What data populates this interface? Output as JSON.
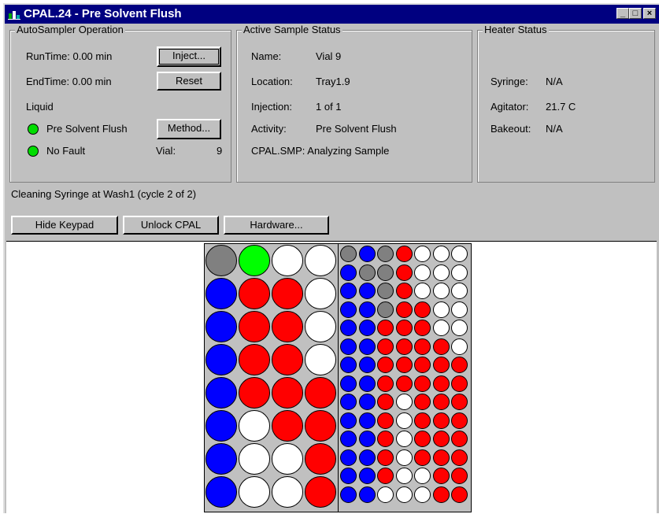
{
  "window": {
    "title": "CPAL.24 - Pre Solvent Flush"
  },
  "autosampler": {
    "title": "AutoSampler Operation",
    "runtime": "RunTime:  0.00 min",
    "endtime": "EndTime:  0.00 min",
    "liquid": "Liquid",
    "status1": "Pre Solvent Flush",
    "status2": "No Fault",
    "vial_label": "Vial:",
    "vial_value": "9",
    "inject_btn": "Inject...",
    "reset_btn": "Reset",
    "method_btn": "Method..."
  },
  "active": {
    "title": "Active Sample Status",
    "rows": [
      {
        "label": "Name:",
        "value": "Vial 9"
      },
      {
        "label": "Location:",
        "value": "Tray1.9"
      },
      {
        "label": "Injection:",
        "value": "1 of 1"
      },
      {
        "label": "Activity:",
        "value": "Pre Solvent Flush"
      }
    ],
    "status_line": "CPAL.SMP: Analyzing Sample"
  },
  "heater": {
    "title": "Heater Status",
    "rows": [
      {
        "label": "Syringe:",
        "value": "N/A"
      },
      {
        "label": "Agitator:",
        "value": "21.7 C"
      },
      {
        "label": "Bakeout:",
        "value": "N/A"
      }
    ]
  },
  "message": "Cleaning Syringe at Wash1 (cycle 2 of 2)",
  "buttons": {
    "hide_keypad": "Hide Keypad",
    "unlock": "Unlock CPAL",
    "hardware": "Hardware..."
  },
  "colors": {
    "gray": "#808080",
    "green": "#00ff00",
    "white": "#ffffff",
    "blue": "#0000ff",
    "red": "#ff0000"
  },
  "large_tray": [
    [
      "gray",
      "green",
      "white",
      "white"
    ],
    [
      "blue",
      "red",
      "red",
      "white"
    ],
    [
      "blue",
      "red",
      "red",
      "white"
    ],
    [
      "blue",
      "red",
      "red",
      "white"
    ],
    [
      "blue",
      "red",
      "red",
      "red"
    ],
    [
      "blue",
      "white",
      "red",
      "red"
    ],
    [
      "blue",
      "white",
      "white",
      "red"
    ],
    [
      "blue",
      "white",
      "white",
      "red"
    ]
  ],
  "small_tray": [
    [
      "gray",
      "blue",
      "gray",
      "red",
      "white",
      "white",
      "white"
    ],
    [
      "blue",
      "gray",
      "gray",
      "red",
      "white",
      "white",
      "white"
    ],
    [
      "blue",
      "blue",
      "gray",
      "red",
      "white",
      "white",
      "white"
    ],
    [
      "blue",
      "blue",
      "gray",
      "red",
      "red",
      "white",
      "white"
    ],
    [
      "blue",
      "blue",
      "red",
      "red",
      "red",
      "white",
      "white"
    ],
    [
      "blue",
      "blue",
      "red",
      "red",
      "red",
      "red",
      "white"
    ],
    [
      "blue",
      "blue",
      "red",
      "red",
      "red",
      "red",
      "red"
    ],
    [
      "blue",
      "blue",
      "red",
      "red",
      "red",
      "red",
      "red"
    ],
    [
      "blue",
      "blue",
      "red",
      "white",
      "red",
      "red",
      "red"
    ],
    [
      "blue",
      "blue",
      "red",
      "white",
      "red",
      "red",
      "red"
    ],
    [
      "blue",
      "blue",
      "red",
      "white",
      "red",
      "red",
      "red"
    ],
    [
      "blue",
      "blue",
      "red",
      "white",
      "red",
      "red",
      "red"
    ],
    [
      "blue",
      "blue",
      "red",
      "white",
      "white",
      "red",
      "red"
    ],
    [
      "blue",
      "blue",
      "white",
      "white",
      "white",
      "red",
      "red"
    ]
  ]
}
